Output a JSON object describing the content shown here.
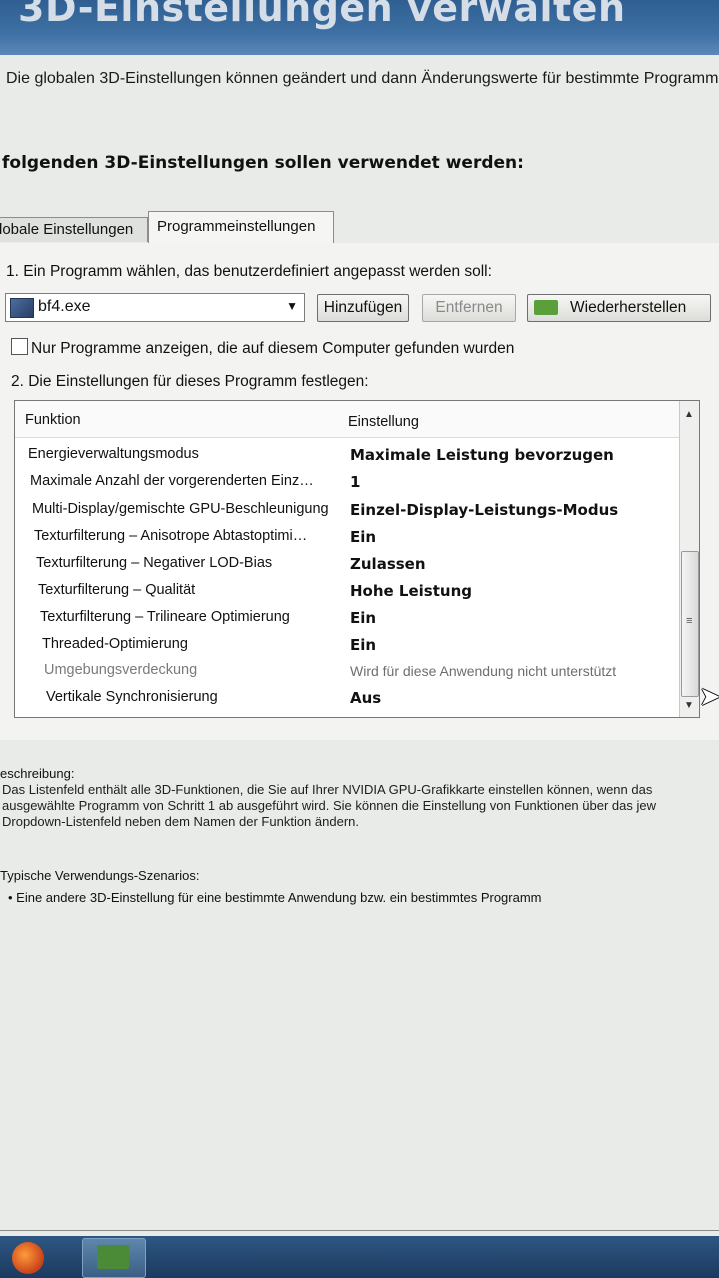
{
  "window": {
    "title": "3D-Einstellungen verwalten",
    "intro": "Die globalen 3D-Einstellungen können geändert und dann Änderungswerte für bestimmte Programm"
  },
  "section_heading": "folgenden 3D-Einstellungen sollen verwendet werden:",
  "tabs": [
    {
      "label": "lobale Einstellungen",
      "active": false
    },
    {
      "label": "Programmeinstellungen",
      "active": true
    }
  ],
  "program": {
    "step1_label": "1. Ein Programm wählen, das benutzerdefiniert angepasst werden soll:",
    "selected": "bf4.exe",
    "add_button": "Hinzufügen",
    "remove_button": "Entfernen",
    "restore_button": "Wiederherstellen",
    "checkbox_label": "Nur Programme anzeigen, die auf diesem Computer gefunden wurden",
    "checkbox_checked": false
  },
  "settings": {
    "step2_label": "2. Die Einstellungen für dieses Programm festlegen:",
    "col_function": "Funktion",
    "col_setting": "Einstellung",
    "rows": [
      {
        "function": "Energieverwaltungsmodus",
        "value": "Maximale Leistung bevorzugen",
        "disabled": false
      },
      {
        "function": "Maximale Anzahl der vorgerenderten Einz…",
        "value": "1",
        "disabled": false
      },
      {
        "function": "Multi-Display/gemischte GPU-Beschleunigung",
        "value": "Einzel-Display-Leistungs-Modus",
        "disabled": false
      },
      {
        "function": "Texturfilterung – Anisotrope Abtastoptimi…",
        "value": "Ein",
        "disabled": false
      },
      {
        "function": "Texturfilterung – Negativer LOD-Bias",
        "value": "Zulassen",
        "disabled": false
      },
      {
        "function": "Texturfilterung – Qualität",
        "value": "Hohe Leistung",
        "disabled": false
      },
      {
        "function": "Texturfilterung – Trilineare Optimierung",
        "value": "Ein",
        "disabled": false
      },
      {
        "function": "Threaded-Optimierung",
        "value": "Ein",
        "disabled": false
      },
      {
        "function": "Umgebungsverdeckung",
        "value": "Wird für diese Anwendung nicht unterstützt",
        "disabled": true
      },
      {
        "function": "Vertikale Synchronisierung",
        "value": "Aus",
        "disabled": false
      }
    ]
  },
  "description": {
    "title": "eschreibung:",
    "lines": [
      "Das Listenfeld enthält alle 3D-Funktionen, die Sie auf Ihrer NVIDIA GPU-Grafikkarte einstellen können, wenn das",
      "ausgewählte Programm von Schritt 1 ab ausgeführt wird. Sie können die Einstellung von Funktionen über das jew",
      "Dropdown-Listenfeld neben dem Namen der Funktion ändern."
    ]
  },
  "scenarios": {
    "title": "Typische Verwendungs-Szenarios:",
    "items": [
      "Eine andere 3D-Einstellung für eine bestimmte Anwendung bzw. ein bestimmtes Programm"
    ]
  },
  "icons": {
    "program": "application-icon",
    "dropdown": "chevron-down-icon",
    "nvidia": "nvidia-logo-icon",
    "scroll_up": "scroll-up-icon",
    "scroll_down": "scroll-down-icon"
  }
}
